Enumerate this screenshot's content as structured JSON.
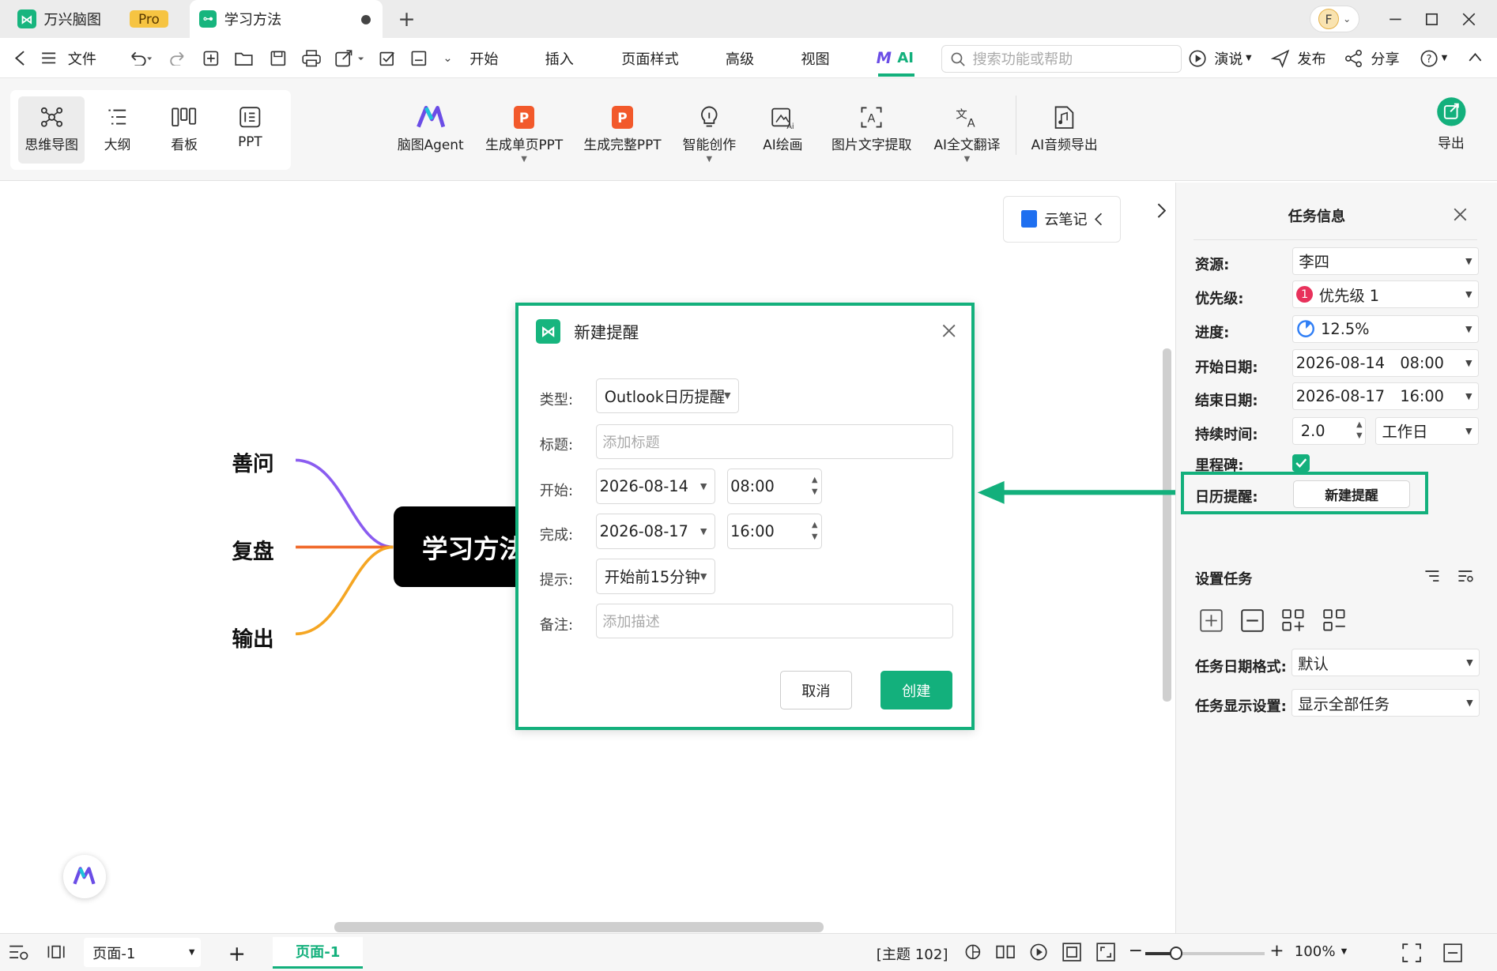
{
  "colors": {
    "accent": "#13b07c",
    "branch_purple": "#8a5cf0",
    "branch_orange": "#f06a2b",
    "branch_yellow": "#f5a623",
    "central": "#000000"
  },
  "titlebar": {
    "app_name": "万兴脑图",
    "pro_badge": "Pro",
    "doc_tab": "学习方法",
    "avatar_letter": "F"
  },
  "menu": {
    "file": "文件",
    "start": "开始",
    "insert": "插入",
    "page_style": "页面样式",
    "advanced": "高级",
    "view": "视图",
    "ai": "AI",
    "search_placeholder": "搜索功能或帮助",
    "present": "演说",
    "publish": "发布",
    "share": "分享"
  },
  "ribbon": {
    "views": [
      "思维导图",
      "大纲",
      "看板",
      "PPT"
    ],
    "ai_tools": [
      "脑图Agent",
      "生成单页PPT",
      "生成完整PPT",
      "智能创作",
      "AI绘画",
      "图片文字提取",
      "AI全文翻译",
      "AI音频导出"
    ],
    "export": "导出"
  },
  "cloud_note": "云笔记",
  "mindmap": {
    "central": "学习方法",
    "branches": [
      "善问",
      "复盘",
      "输出"
    ]
  },
  "dialog": {
    "title": "新建提醒",
    "type_label": "类型:",
    "type_value": "Outlook日历提醒",
    "title_label": "标题:",
    "title_placeholder": "添加标题",
    "start_label": "开始:",
    "start_date": "2026-08-14",
    "start_time": "08:00",
    "end_label": "完成:",
    "end_date": "2026-08-17",
    "end_time": "16:00",
    "remind_label": "提示:",
    "remind_value": "开始前15分钟",
    "note_label": "备注:",
    "note_placeholder": "添加描述",
    "cancel": "取消",
    "create": "创建"
  },
  "panel": {
    "title": "任务信息",
    "resource_label": "资源:",
    "resource_value": "李四",
    "priority_label": "优先级:",
    "priority_badge": "1",
    "priority_value": "优先级 1",
    "progress_label": "进度:",
    "progress_value": "12.5%",
    "progress_fraction": 0.125,
    "start_label": "开始日期:",
    "start_date": "2026-08-14",
    "start_time": "08:00",
    "end_label": "结束日期:",
    "end_date": "2026-08-17",
    "end_time": "16:00",
    "duration_label": "持续时间:",
    "duration_value": "2.0",
    "duration_unit": "工作日",
    "milestone_label": "里程碑:",
    "milestone_checked": true,
    "calendar_label": "日历提醒:",
    "new_reminder": "新建提醒",
    "set_task": "设置任务",
    "date_format_label": "任务日期格式:",
    "date_format_value": "默认",
    "display_label": "任务显示设置:",
    "display_value": "显示全部任务"
  },
  "status": {
    "page_select": "页面-1",
    "page_tab": "页面-1",
    "topic_count": "[主题 102]",
    "zoom": "100%"
  }
}
